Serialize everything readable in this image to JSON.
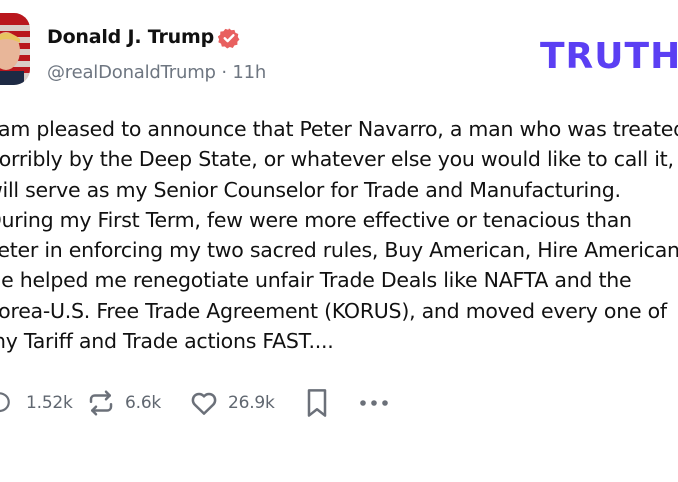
{
  "author": {
    "name": "Donald J. Trump",
    "handle": "@realDonaldTrump",
    "separator": "·",
    "time": "11h",
    "verified_icon": "verified-badge-icon"
  },
  "brand": {
    "logo_text": "TRUTH"
  },
  "post": {
    "lines": [
      "I am pleased to announce that Peter Navarro, a man who was treated",
      "horribly by the Deep State, or whatever else you would like to call it,",
      "will serve as my Senior Counselor for Trade and Manufacturing.",
      "During my First Term, few were more effective or tenacious than",
      "Peter in enforcing my two sacred rules, Buy American, Hire American.",
      "He helped me renegotiate unfair Trade Deals like NAFTA and the",
      "Korea-U.S. Free Trade Agreement (KORUS), and moved every one of",
      "my Tariff and Trade actions FAST...."
    ]
  },
  "actions": {
    "replies": "1.52k",
    "retruths": "6.6k",
    "likes": "26.9k",
    "icons": [
      "reply-icon",
      "retruth-icon",
      "like-icon",
      "bookmark-icon",
      "more-icon"
    ]
  },
  "colors": {
    "brand": "#5b3ff3",
    "verified": "#e8605f",
    "muted": "#6e7681"
  }
}
